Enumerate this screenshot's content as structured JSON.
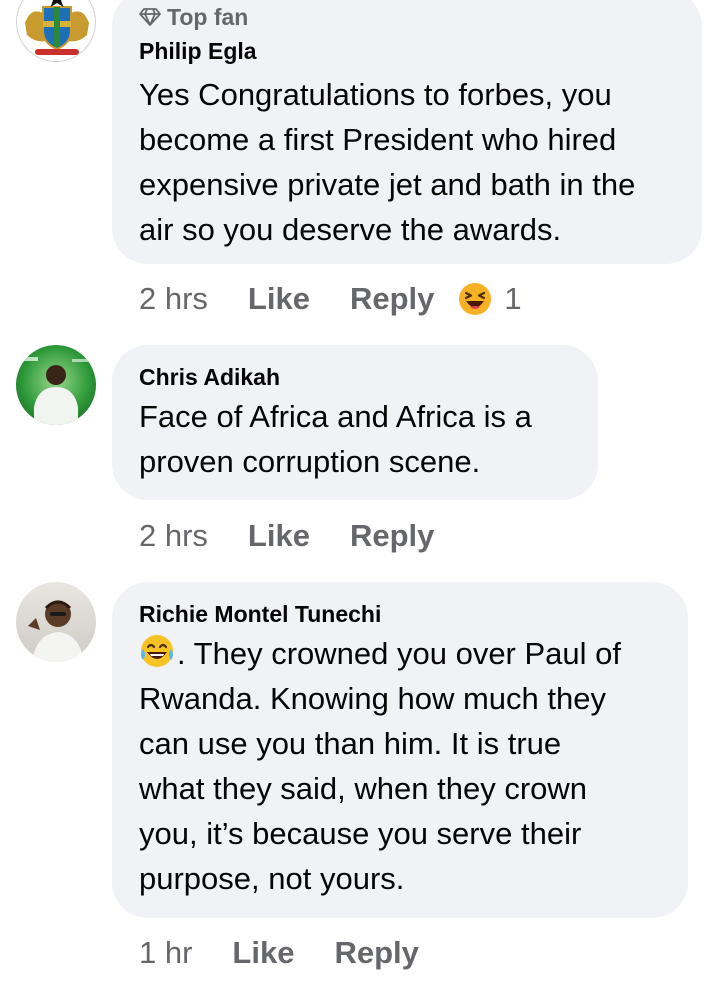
{
  "comments": [
    {
      "badge": "Top fan",
      "author": "Philip Egla",
      "text": "Yes Congratulations to forbes, you\nbecome a first President who  hired\nexpensive private jet and bath in the\nair so you deserve the awards.",
      "time": "2 hrs",
      "like": "Like",
      "reply": "Reply",
      "reaction_count": "1",
      "avatar_icon": "ghana-coat-of-arms-avatar"
    },
    {
      "author": "Chris Adikah",
      "text": "Face of Africa and Africa is a\nproven corruption scene.",
      "time": "2 hrs",
      "like": "Like",
      "reply": "Reply",
      "avatar_icon": "profile-photo-avatar"
    },
    {
      "author": "Richie Montel Tunechi",
      "text": ". They crowned you over Paul of\nRwanda. Knowing how much they\ncan use you than him. It is true\nwhat they said, when they crown\nyou, it’s because you serve their\npurpose, not yours.",
      "time": "1 hr",
      "like": "Like",
      "reply": "Reply",
      "avatar_icon": "profile-photo-avatar"
    }
  ],
  "colors": {
    "bubble": "#f0f2f5",
    "secondary_text": "#65676b",
    "primary_text": "#050505",
    "haha_emoji": "#f7b125"
  }
}
